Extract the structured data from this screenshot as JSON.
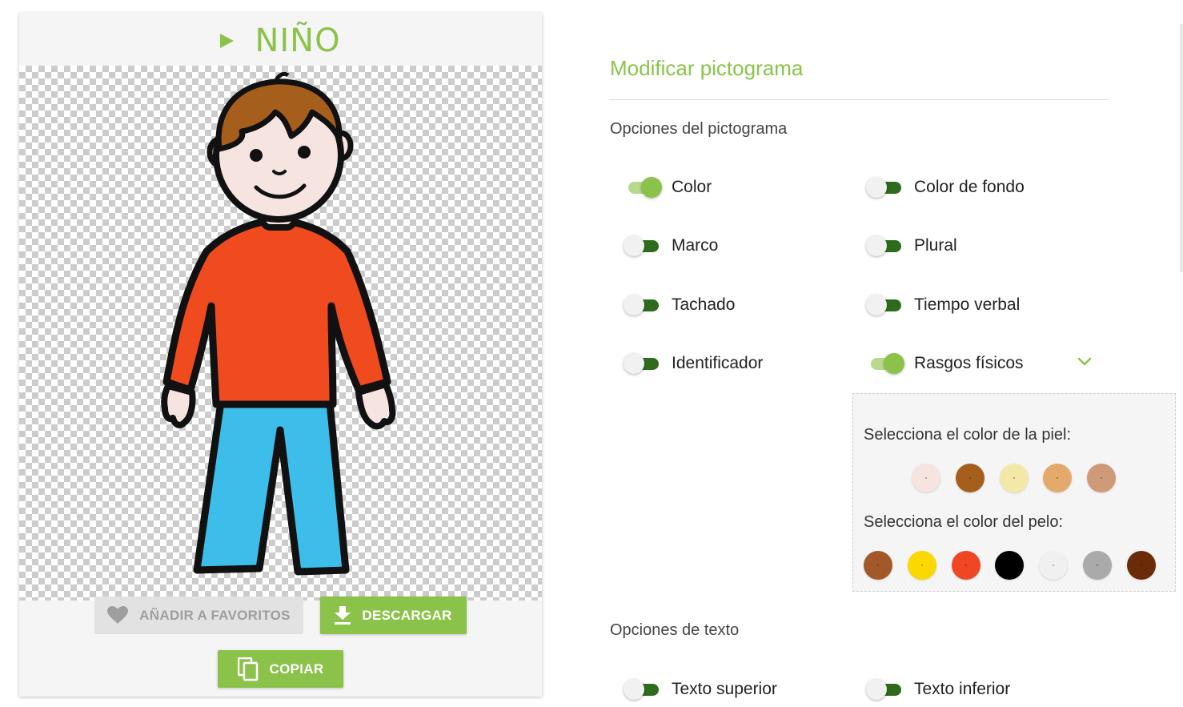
{
  "picto": {
    "title": "NIÑO",
    "buttons": {
      "favorites": "AÑADIR A FAVORITOS",
      "download": "DESCARGAR",
      "copy": "COPIAR"
    }
  },
  "panel": {
    "title": "Modificar pictograma",
    "picto_options_title": "Opciones del pictograma",
    "options": [
      {
        "label": "Color",
        "on": true
      },
      {
        "label": "Color de fondo",
        "on": false
      },
      {
        "label": "Marco",
        "on": false
      },
      {
        "label": "Plural",
        "on": false
      },
      {
        "label": "Tachado",
        "on": false
      },
      {
        "label": "Tiempo verbal",
        "on": false
      },
      {
        "label": "Identificador",
        "on": false
      },
      {
        "label": "Rasgos físicos",
        "on": true
      }
    ],
    "features": {
      "skin_label": "Selecciona el color de la piel:",
      "skin_colors": [
        "#f5e4df",
        "#a65e1c",
        "#f4e8a8",
        "#e3aa6c",
        "#cf9a78"
      ],
      "hair_label": "Selecciona el color del pelo:",
      "hair_colors": [
        "#a3582a",
        "#fbd800",
        "#ef4724",
        "#000000",
        "#f0f0f0",
        "#aaaaaa",
        "#6b2b08"
      ]
    },
    "text_options_title": "Opciones de texto",
    "text_options": [
      {
        "label": "Texto superior",
        "on": false
      },
      {
        "label": "Texto inferior",
        "on": false
      }
    ]
  },
  "colors": {
    "accent": "#8bc34a",
    "switch_off_track": "#2e6b1d",
    "shirt": "#f04a1f",
    "pants": "#3dbde9",
    "hair": "#a65e1c",
    "skin": "#f5e4df"
  }
}
